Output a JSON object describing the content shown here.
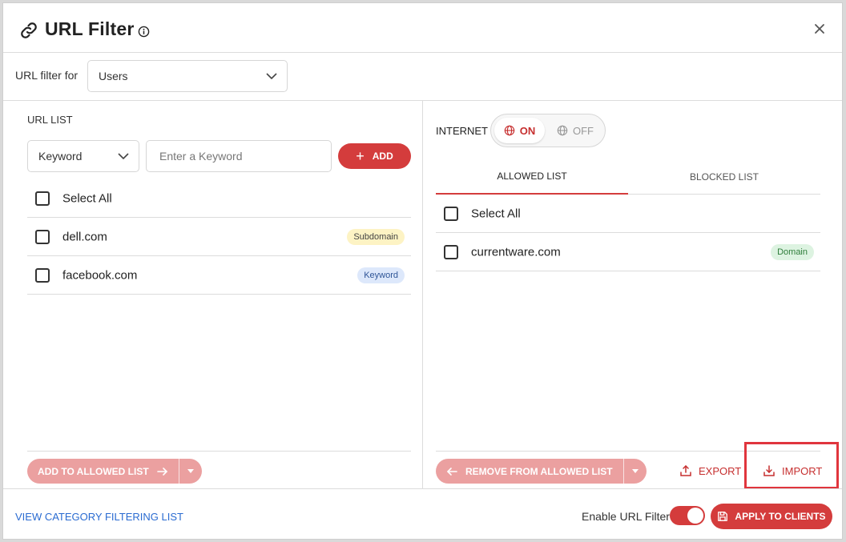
{
  "dialog": {
    "title": "URL Filter"
  },
  "filter_for": {
    "label": "URL filter for",
    "selected": "Users"
  },
  "url_list": {
    "section_label": "URL LIST",
    "type_selected": "Keyword",
    "input_placeholder": "Enter a Keyword",
    "add_label": "ADD",
    "select_all_label": "Select All",
    "items": [
      {
        "text": "dell.com",
        "tag": "Subdomain"
      },
      {
        "text": "facebook.com",
        "tag": "Keyword"
      }
    ],
    "add_to_allowed_label": "ADD TO ALLOWED LIST"
  },
  "internet": {
    "label": "INTERNET",
    "on_label": "ON",
    "off_label": "OFF",
    "state": "ON"
  },
  "tabs": [
    {
      "label": "ALLOWED LIST",
      "active": true
    },
    {
      "label": "BLOCKED LIST",
      "active": false
    }
  ],
  "allowed_list": {
    "select_all_label": "Select All",
    "items": [
      {
        "text": "currentware.com",
        "tag": "Domain"
      }
    ],
    "remove_label": "REMOVE FROM ALLOWED LIST",
    "export_label": "EXPORT",
    "import_label": "IMPORT"
  },
  "footer": {
    "category_link": "VIEW CATEGORY FILTERING LIST",
    "enable_label": "Enable URL Filter",
    "enable_state": true,
    "apply_label": "APPLY TO CLIENTS"
  },
  "colors": {
    "accent": "#d43c3c",
    "accent_disabled": "#eba0a0",
    "link": "#2a6bd1",
    "highlight": "#e0353d"
  }
}
